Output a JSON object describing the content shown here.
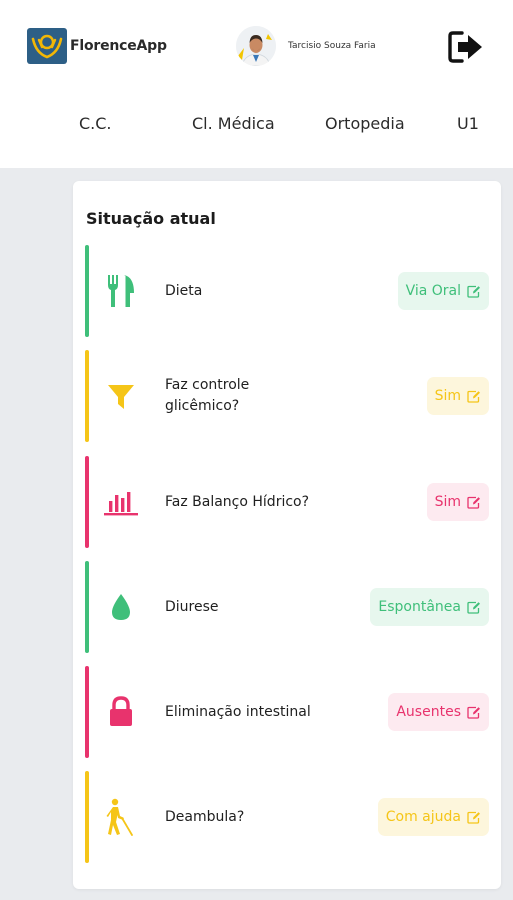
{
  "header": {
    "app_name": "FlorenceApp",
    "user_name": "Tarcisio Souza Faria"
  },
  "tabs": [
    "C.C.",
    "Cl. Médica",
    "Ortopedia",
    "U1"
  ],
  "section": {
    "title": "Situação atual"
  },
  "items": [
    {
      "label": "Dieta",
      "value": "Via Oral",
      "color": "#3fbf7a",
      "bg": "#e7f7ee",
      "icon": "fork-knife-icon"
    },
    {
      "label": "Faz controle glicêmico?",
      "value": "Sim",
      "color": "#f5c518",
      "bg": "#fdf6dc",
      "icon": "filter-icon"
    },
    {
      "label": "Faz Balanço Hídrico?",
      "value": "Sim",
      "color": "#e8336d",
      "bg": "#fdeaf0",
      "icon": "bar-chart-icon"
    },
    {
      "label": "Diurese",
      "value": "Espontânea",
      "color": "#3fbf7a",
      "bg": "#e7f7ee",
      "icon": "drop-icon"
    },
    {
      "label": "Eliminação intestinal",
      "value": "Ausentes",
      "color": "#e8336d",
      "bg": "#fdeaf0",
      "icon": "lock-icon"
    },
    {
      "label": "Deambula?",
      "value": "Com ajuda",
      "color": "#f5c518",
      "bg": "#fdf6dc",
      "icon": "blind-walking-icon"
    }
  ]
}
